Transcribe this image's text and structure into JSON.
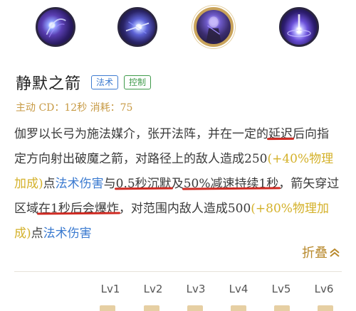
{
  "skill_icons": [
    {
      "name": "skill-1-icon",
      "selected": false
    },
    {
      "name": "skill-2-icon",
      "selected": false
    },
    {
      "name": "skill-3-icon",
      "selected": true
    },
    {
      "name": "skill-4-icon",
      "selected": false
    }
  ],
  "skill": {
    "name": "静默之箭",
    "tags": [
      "法术",
      "控制"
    ],
    "meta": "主动 CD：12秒 消耗：75"
  },
  "description": {
    "p1": "伽罗以长弓为施法媒介，张开法阵，并在一定的",
    "p2": "延迟",
    "p3": "后向指定方向射出破魔之箭，对路径上的敌人造成250",
    "p4": "(+40%物理加成)",
    "p5": "点",
    "p6": "法术伤害",
    "p7": "与",
    "p8": "0.5秒沉默",
    "p9": "及",
    "p10": "50%减速持续1秒",
    "p11": "，箭矢穿过区域",
    "p12": "在1秒后会爆炸",
    "p13": "，对范围内敌人造成500",
    "p14": "(+80%物理加成)",
    "p15": "点",
    "p16": "法术伤害"
  },
  "fold_label": "折叠",
  "levels": [
    "Lv1",
    "Lv2",
    "Lv3",
    "Lv4",
    "Lv5",
    "Lv6"
  ],
  "colors": {
    "accent_gold": "#c79a44",
    "highlight_yellow": "#d4b12a",
    "highlight_blue": "#3a7ad0",
    "underline_red": "#cf2a22",
    "tag_blue": "#3d7bd0",
    "tag_green": "#3f9a4a"
  }
}
